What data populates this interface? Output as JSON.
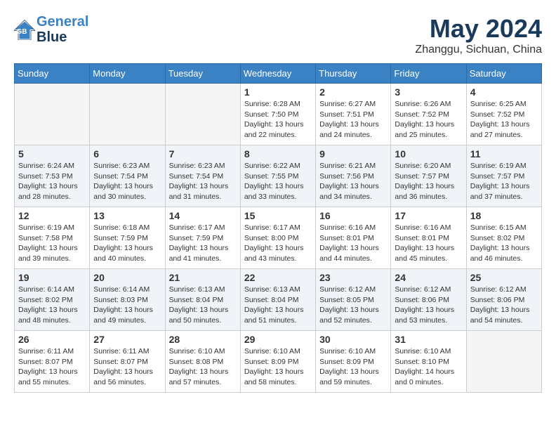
{
  "header": {
    "logo_line1": "General",
    "logo_line2": "Blue",
    "month_year": "May 2024",
    "location": "Zhanggu, Sichuan, China"
  },
  "weekdays": [
    "Sunday",
    "Monday",
    "Tuesday",
    "Wednesday",
    "Thursday",
    "Friday",
    "Saturday"
  ],
  "weeks": [
    [
      {
        "day": "",
        "empty": true
      },
      {
        "day": "",
        "empty": true
      },
      {
        "day": "",
        "empty": true
      },
      {
        "day": "1",
        "sunrise": "6:28 AM",
        "sunset": "7:50 PM",
        "daylight": "13 hours and 22 minutes."
      },
      {
        "day": "2",
        "sunrise": "6:27 AM",
        "sunset": "7:51 PM",
        "daylight": "13 hours and 24 minutes."
      },
      {
        "day": "3",
        "sunrise": "6:26 AM",
        "sunset": "7:52 PM",
        "daylight": "13 hours and 25 minutes."
      },
      {
        "day": "4",
        "sunrise": "6:25 AM",
        "sunset": "7:52 PM",
        "daylight": "13 hours and 27 minutes."
      }
    ],
    [
      {
        "day": "5",
        "sunrise": "6:24 AM",
        "sunset": "7:53 PM",
        "daylight": "13 hours and 28 minutes."
      },
      {
        "day": "6",
        "sunrise": "6:23 AM",
        "sunset": "7:54 PM",
        "daylight": "13 hours and 30 minutes."
      },
      {
        "day": "7",
        "sunrise": "6:23 AM",
        "sunset": "7:54 PM",
        "daylight": "13 hours and 31 minutes."
      },
      {
        "day": "8",
        "sunrise": "6:22 AM",
        "sunset": "7:55 PM",
        "daylight": "13 hours and 33 minutes."
      },
      {
        "day": "9",
        "sunrise": "6:21 AM",
        "sunset": "7:56 PM",
        "daylight": "13 hours and 34 minutes."
      },
      {
        "day": "10",
        "sunrise": "6:20 AM",
        "sunset": "7:57 PM",
        "daylight": "13 hours and 36 minutes."
      },
      {
        "day": "11",
        "sunrise": "6:19 AM",
        "sunset": "7:57 PM",
        "daylight": "13 hours and 37 minutes."
      }
    ],
    [
      {
        "day": "12",
        "sunrise": "6:19 AM",
        "sunset": "7:58 PM",
        "daylight": "13 hours and 39 minutes."
      },
      {
        "day": "13",
        "sunrise": "6:18 AM",
        "sunset": "7:59 PM",
        "daylight": "13 hours and 40 minutes."
      },
      {
        "day": "14",
        "sunrise": "6:17 AM",
        "sunset": "7:59 PM",
        "daylight": "13 hours and 41 minutes."
      },
      {
        "day": "15",
        "sunrise": "6:17 AM",
        "sunset": "8:00 PM",
        "daylight": "13 hours and 43 minutes."
      },
      {
        "day": "16",
        "sunrise": "6:16 AM",
        "sunset": "8:01 PM",
        "daylight": "13 hours and 44 minutes."
      },
      {
        "day": "17",
        "sunrise": "6:16 AM",
        "sunset": "8:01 PM",
        "daylight": "13 hours and 45 minutes."
      },
      {
        "day": "18",
        "sunrise": "6:15 AM",
        "sunset": "8:02 PM",
        "daylight": "13 hours and 46 minutes."
      }
    ],
    [
      {
        "day": "19",
        "sunrise": "6:14 AM",
        "sunset": "8:02 PM",
        "daylight": "13 hours and 48 minutes."
      },
      {
        "day": "20",
        "sunrise": "6:14 AM",
        "sunset": "8:03 PM",
        "daylight": "13 hours and 49 minutes."
      },
      {
        "day": "21",
        "sunrise": "6:13 AM",
        "sunset": "8:04 PM",
        "daylight": "13 hours and 50 minutes."
      },
      {
        "day": "22",
        "sunrise": "6:13 AM",
        "sunset": "8:04 PM",
        "daylight": "13 hours and 51 minutes."
      },
      {
        "day": "23",
        "sunrise": "6:12 AM",
        "sunset": "8:05 PM",
        "daylight": "13 hours and 52 minutes."
      },
      {
        "day": "24",
        "sunrise": "6:12 AM",
        "sunset": "8:06 PM",
        "daylight": "13 hours and 53 minutes."
      },
      {
        "day": "25",
        "sunrise": "6:12 AM",
        "sunset": "8:06 PM",
        "daylight": "13 hours and 54 minutes."
      }
    ],
    [
      {
        "day": "26",
        "sunrise": "6:11 AM",
        "sunset": "8:07 PM",
        "daylight": "13 hours and 55 minutes."
      },
      {
        "day": "27",
        "sunrise": "6:11 AM",
        "sunset": "8:07 PM",
        "daylight": "13 hours and 56 minutes."
      },
      {
        "day": "28",
        "sunrise": "6:10 AM",
        "sunset": "8:08 PM",
        "daylight": "13 hours and 57 minutes."
      },
      {
        "day": "29",
        "sunrise": "6:10 AM",
        "sunset": "8:09 PM",
        "daylight": "13 hours and 58 minutes."
      },
      {
        "day": "30",
        "sunrise": "6:10 AM",
        "sunset": "8:09 PM",
        "daylight": "13 hours and 59 minutes."
      },
      {
        "day": "31",
        "sunrise": "6:10 AM",
        "sunset": "8:10 PM",
        "daylight": "14 hours and 0 minutes."
      },
      {
        "day": "",
        "empty": true
      }
    ]
  ],
  "labels": {
    "sunrise": "Sunrise:",
    "sunset": "Sunset:",
    "daylight": "Daylight:"
  }
}
